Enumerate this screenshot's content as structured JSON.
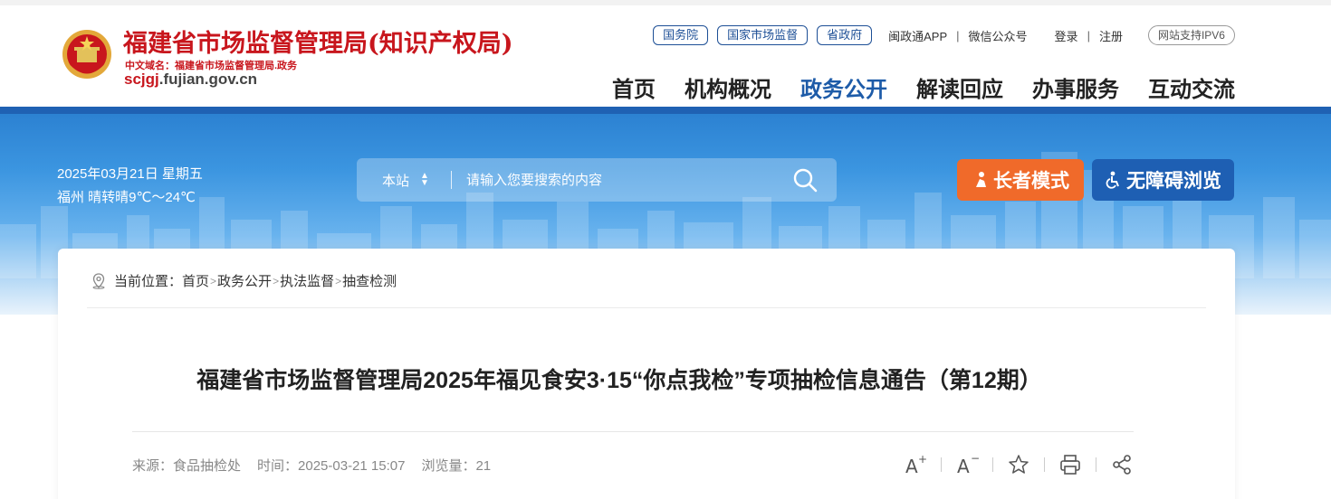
{
  "header": {
    "site_title": "福建省市场监督管理局(知识产权局)",
    "cn_domain": "中文域名：福建省市场监督管理局.政务",
    "en_domain_accent": "scjgj",
    "en_domain_rest": ".fujian.gov.cn",
    "top_pills": [
      "国务院",
      "国家市场监督",
      "省政府"
    ],
    "top_links": [
      "闽政通APP",
      "微信公众号"
    ],
    "login": "登录",
    "register": "注册",
    "separator": "|",
    "ipv6": "网站支持IPV6",
    "nav": [
      {
        "label": "首页",
        "active": false
      },
      {
        "label": "机构概况",
        "active": false
      },
      {
        "label": "政务公开",
        "active": true
      },
      {
        "label": "解读回应",
        "active": false
      },
      {
        "label": "办事服务",
        "active": false
      },
      {
        "label": "互动交流",
        "active": false
      }
    ]
  },
  "banner": {
    "date": "2025年03月21日 星期五",
    "weather": "福州 晴转晴9℃～24℃",
    "search_scope": "本站",
    "search_placeholder": "请输入您要搜索的内容",
    "elder_mode": "长者模式",
    "accessible": "无障碍浏览"
  },
  "article": {
    "breadcrumb_prefix": "当前位置：",
    "breadcrumb": [
      "首页",
      "政务公开",
      "执法监督",
      "抽查检测"
    ],
    "breadcrumb_sep": ">",
    "title": "福建省市场监督管理局2025年福见食安3·15“你点我检”专项抽检信息通告（第12期）",
    "source": "来源：食品抽检处",
    "time": "时间：2025-03-21 15:07",
    "views": "浏览量：21"
  },
  "colors": {
    "brand_red": "#c8161d",
    "nav_active": "#1d5ba8",
    "elder_orange": "#f06a2a",
    "access_blue": "#1e5fb3"
  },
  "icons": [
    "emblem-icon",
    "search-icon",
    "elder-icon",
    "accessibility-icon",
    "location-icon",
    "font-increase-icon",
    "font-decrease-icon",
    "star-icon",
    "print-icon",
    "share-icon"
  ]
}
